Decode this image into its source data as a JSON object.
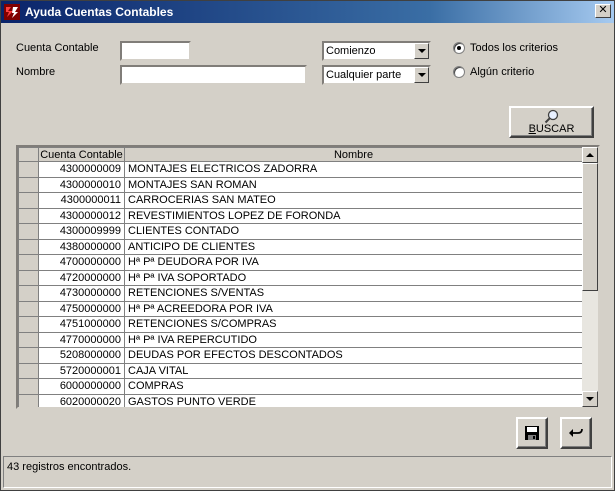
{
  "window": {
    "title": "Ayuda Cuentas Contables"
  },
  "form": {
    "cuenta_label": "Cuenta Contable",
    "cuenta_value": "",
    "nombre_label": "Nombre",
    "nombre_value": "",
    "cuenta_match": "Comienzo",
    "nombre_match": "Cualquier parte",
    "radio_all": "Todos los criterios",
    "radio_any": "Algún criterio",
    "selected_criterion": "Todos los criterios"
  },
  "search_button": {
    "label": "BUSCAR"
  },
  "grid": {
    "columns": [
      "Cuenta Contable",
      "Nombre"
    ],
    "rows": [
      [
        "4300000009",
        "MONTAJES ELECTRICOS ZADORRA"
      ],
      [
        "4300000010",
        "MONTAJES SAN ROMAN"
      ],
      [
        "4300000011",
        "CARROCERIAS SAN MATEO"
      ],
      [
        "4300000012",
        "REVESTIMIENTOS LOPEZ DE FORONDA"
      ],
      [
        "4300009999",
        "CLIENTES CONTADO"
      ],
      [
        "4380000000",
        "ANTICIPO DE CLIENTES"
      ],
      [
        "4700000000",
        "Hª Pª DEUDORA POR IVA"
      ],
      [
        "4720000000",
        "Hª Pª IVA SOPORTADO"
      ],
      [
        "4730000000",
        "RETENCIONES S/VENTAS"
      ],
      [
        "4750000000",
        "Hª Pª ACREEDORA POR IVA"
      ],
      [
        "4751000000",
        "RETENCIONES S/COMPRAS"
      ],
      [
        "4770000000",
        "Hª Pª IVA REPERCUTIDO"
      ],
      [
        "5208000000",
        "DEUDAS POR EFECTOS DESCONTADOS"
      ],
      [
        "5720000001",
        "CAJA VITAL"
      ],
      [
        "6000000000",
        "COMPRAS"
      ],
      [
        "6020000020",
        "GASTOS PUNTO VERDE"
      ]
    ]
  },
  "status": {
    "text": "43 registros encontrados."
  },
  "icons": {
    "app": "app-icon",
    "close": "close-icon",
    "search": "magnifier-icon",
    "save": "floppy-disk-icon",
    "undo": "undo-arrow-icon"
  }
}
